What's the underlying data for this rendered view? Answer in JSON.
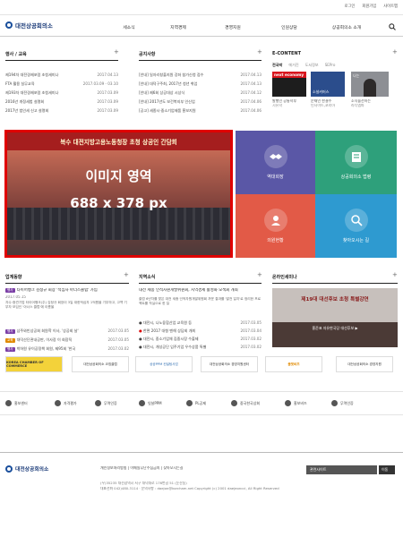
{
  "util": {
    "login": "로그인",
    "join": "회원가입",
    "sitemap": "사이트맵"
  },
  "brand": {
    "logo": "대전상공회의소"
  },
  "nav": [
    "세소식",
    "지역경제",
    "경영지원",
    "인원상담",
    "상공회의소 소개"
  ],
  "notice_left": {
    "title": "행사 / 교육",
    "items": [
      {
        "t": "제194차 대전경제포럼 초청세미나",
        "d": "2017.04.13"
      },
      {
        "t": "FTA 활용 실무교육",
        "d": "2017.03.09 - 03.10"
      },
      {
        "t": "제193차 대전경제포럼 초청세미나",
        "d": "2017.03.09"
      },
      {
        "t": "2016년 개정세법 설명회",
        "d": "2017.03.09"
      },
      {
        "t": "2017년 법인세 신고 설명회",
        "d": "2017.03.09"
      }
    ]
  },
  "notice_mid": {
    "title": "공지사항",
    "items": [
      {
        "t": "[안내] 일자리창출지원 강좌 참가신청 접수",
        "d": "2017.04.13"
      },
      {
        "t": "[안내] 대덕구주최, 2017년 청년 취업",
        "d": "2017.04.13"
      },
      {
        "t": "[안내] 제6회 상공대상 시상식",
        "d": "2017.04.12"
      },
      {
        "t": "[안내] 2017년도 보건복지부 인신업",
        "d": "2017.04.06"
      },
      {
        "t": "[공고] 세종시·중소기업제품 홍보지원",
        "d": "2017.04.06"
      }
    ]
  },
  "econtent": {
    "title": "E-CONTENT",
    "tabs": [
      "전국박",
      "에거진",
      "도서정보",
      "SEPro"
    ],
    "cards": [
      {
        "img": "next economy",
        "cap": "발행인 공통학부",
        "sub": "시유학"
      },
      {
        "img": "소설커머스",
        "cap": "문재인 한결수",
        "sub": "인사이트,코리아"
      },
      {
        "img": "나는",
        "cap": "소식을전하는",
        "sub": "라디엠파"
      }
    ]
  },
  "banner": {
    "heading": "복수 대전지방고용노동청장 초청 상공인 간담회",
    "placeholder": "이미지 영역",
    "size": "688 x 378 px"
  },
  "quick": [
    {
      "label": "역대회장",
      "color": "#5a57a6",
      "icon": "handshake-icon"
    },
    {
      "label": "상공회의소 법령",
      "color": "#2ea07b",
      "icon": "law-book-icon"
    },
    {
      "label": "의원현황",
      "color": "#e25a47",
      "icon": "members-icon"
    },
    {
      "label": "찾아오시는 길",
      "color": "#2e9ad0",
      "icon": "map-search-icon"
    }
  ],
  "industry": {
    "title": "업계동향",
    "headline": "타이어뱅크 김정규 회장 '적십자 아너스클럽' 가입",
    "date": "2017.05.15",
    "desc": "자수·중견기업 타이어뱅크(주) 김정규 회장이 3일 대한적십자 1억원을 기부하고, 고액 기부자 모임인 '아너스 클럽'에 이름을",
    "items": [
      {
        "tag": "행사",
        "tagColor": "#7b3fa6",
        "t": "삼주와빈상공회 회원학 이사, '상공회 날'",
        "d": "2017.03.05"
      },
      {
        "tag": "교육",
        "tagColor": "#e08a00",
        "t": "대덕산단관내공판, 이사장 이 회장직",
        "d": "2017.03.05"
      },
      {
        "tag": "행사",
        "tagColor": "#7b3fa6",
        "t": "박하원 유이공정책 회원, 제95회 '한국",
        "d": "2017.03.02"
      }
    ]
  },
  "regional": {
    "title": "지역소식",
    "headline": "대전 세종 인적자원개발위원회, 지역경제 활성화 모색회 개최",
    "desc": "출범 6년차를 맞은 대전 세종 인적자원개발위원회 까운 결과를 '발전 일지'로 정리한 프로젝트를 착실으로 한 킬",
    "items": [
      {
        "t": "대전시, 나노융합산업 교육원 등",
        "d": "2017.03.05"
      },
      {
        "t": "한편 2017 대형 멘해 상담회 개최",
        "d": "2017.03.04"
      },
      {
        "t": "대전시, 중소기업체 집중시장 수출제",
        "d": "2017.03.02"
      },
      {
        "t": "대전시, 개성공단 입주기업 우수상품 특별",
        "d": "2017.03.02"
      }
    ]
  },
  "seminar": {
    "title": "온라인세미나",
    "slide_title": "제19대 대선후보 초청 특별강연",
    "slide_sub": "홍준표 자유한국당 대선후보 ▶"
  },
  "partners": [
    "KOREA CHAMBER OF COMMERCE",
    "대전상공회의소 코칭클럽",
    "상공PPM 컨설팅사업",
    "대전상공회의소 경영지원센터",
    "올댓비즈",
    "대전상공회의소 경영지원"
  ],
  "quick_links": [
    "홍보센터",
    "자격평가",
    "무역인증",
    "잇살PPM",
    "PL공제",
    "중국한국상회",
    "홍보비즈",
    "무역인증"
  ],
  "footer": {
    "logo": "대전상공회의소",
    "links": "개인정보처리방침 | 이메일무단수집금지 | 찾아오시는길",
    "address": "(우)35235 대전광역시 서구 대덕대로 176번길 51 (둔산동)",
    "contact": "대표전화 042)480-3114 · 문의사항 : daejon@korcham.net Copyright (c) 2001 daejeoncci, All Right Reserved",
    "select": "관련사이트",
    "go": "이동"
  }
}
